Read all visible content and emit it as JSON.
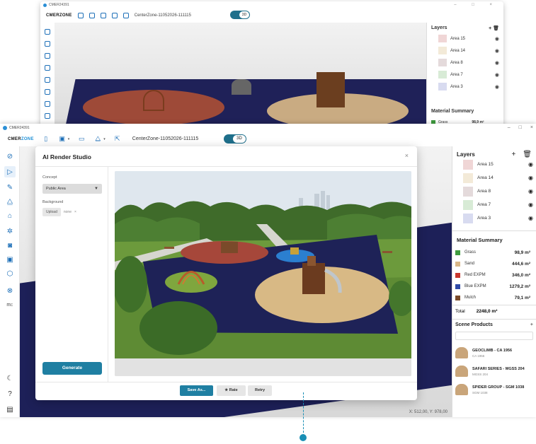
{
  "back_window": {
    "app_short": "CMER24391",
    "brand": "CMERZONE",
    "project_name": "CenterZone-11052026-111115",
    "toggle_label": "3D",
    "layers_title": "Layers",
    "layers": [
      {
        "name": "Area 15",
        "color": "#f0d6d6"
      },
      {
        "name": "Area 14",
        "color": "#f3ead8"
      },
      {
        "name": "Area 8",
        "color": "#e4dadb"
      },
      {
        "name": "Area 7",
        "color": "#d8ebd6"
      },
      {
        "name": "Area 3",
        "color": "#d8dbf0"
      }
    ],
    "material_summary_title": "Material Summary",
    "first_material": {
      "name": "Grass",
      "value": "98,9 m²",
      "color": "#3f9c3f"
    }
  },
  "titlebar": {
    "app_short": "CMER24391",
    "controls": [
      "–",
      "□",
      "×"
    ]
  },
  "toolbar": {
    "brand_a": "CMER",
    "brand_b": "ZONE",
    "project_name": "CenterZone-11052026-111115",
    "toggle_label": "3D"
  },
  "leftbar": {
    "icons": [
      {
        "name": "home-icon",
        "glyph": "⊘"
      },
      {
        "name": "select-cursor-icon",
        "glyph": "▷"
      },
      {
        "name": "pencil-icon",
        "glyph": "✎"
      },
      {
        "name": "nodes-icon",
        "glyph": "⧋"
      },
      {
        "name": "bell-icon",
        "glyph": "⌂"
      },
      {
        "name": "sparkle-icon",
        "glyph": "✲"
      },
      {
        "name": "camera-icon",
        "glyph": "◙"
      },
      {
        "name": "image-icon",
        "glyph": "▣"
      },
      {
        "name": "cube-icon",
        "glyph": "⬡"
      },
      {
        "name": "eye-off-icon",
        "glyph": "⊗"
      },
      {
        "name": "measure-icon",
        "glyph": "m↕"
      }
    ],
    "bottom": [
      {
        "name": "moon-icon",
        "glyph": "☾"
      },
      {
        "name": "help-icon",
        "glyph": "?"
      },
      {
        "name": "keyboard-icon",
        "glyph": "▤"
      }
    ]
  },
  "right_panel": {
    "layers_title": "Layers",
    "add_glyph": "+",
    "delete_glyph": "🗑",
    "layers": [
      {
        "name": "Area 15",
        "color": "#f0d6d6"
      },
      {
        "name": "Area 14",
        "color": "#f3ead8"
      },
      {
        "name": "Area 8",
        "color": "#e4dadb"
      },
      {
        "name": "Area 7",
        "color": "#d8ebd6"
      },
      {
        "name": "Area 3",
        "color": "#d8dbf0"
      }
    ],
    "eye_glyph": "◉",
    "material_summary_title": "Material Summary",
    "materials": [
      {
        "name": "Grass",
        "value": "98,9 m²",
        "color": "#3f9c3f"
      },
      {
        "name": "Sand",
        "value": "444,6 m²",
        "color": "#d9b787"
      },
      {
        "name": "Red EXPM",
        "value": "346,0 m²",
        "color": "#c8362d"
      },
      {
        "name": "Blue EXPM",
        "value": "1279,2 m²",
        "color": "#2f4aa8"
      },
      {
        "name": "Mulch",
        "value": "79,1 m²",
        "color": "#7a4a2a"
      }
    ],
    "total_label": "Total",
    "total_value": "2248,0 m²",
    "scene_products_title": "Scene Products",
    "scene_products_plus": "+",
    "products": [
      {
        "name": "GEOCLIMB - CA 1956",
        "code": "CA 1956"
      },
      {
        "name": "SAFARI SERIES - MGSS 204",
        "code": "MGSS 204"
      },
      {
        "name": "SPIDER GROUP - SGM 1038",
        "code": "SGM 1038"
      }
    ]
  },
  "viewport": {
    "coords": "X: 512,00, Y: 978,00"
  },
  "modal": {
    "title": "AI Render Studio",
    "close_glyph": "×",
    "concept_label": "Concept",
    "concept_value": "Public Area",
    "concept_arrow": "▼",
    "background_label": "Background",
    "upload_label": "Upload",
    "none_label": "none",
    "clear_glyph": "×",
    "generate_label": "Generate",
    "save_as_label": "Save As...",
    "rate_label": "★ Rate",
    "retry_label": "Retry"
  }
}
